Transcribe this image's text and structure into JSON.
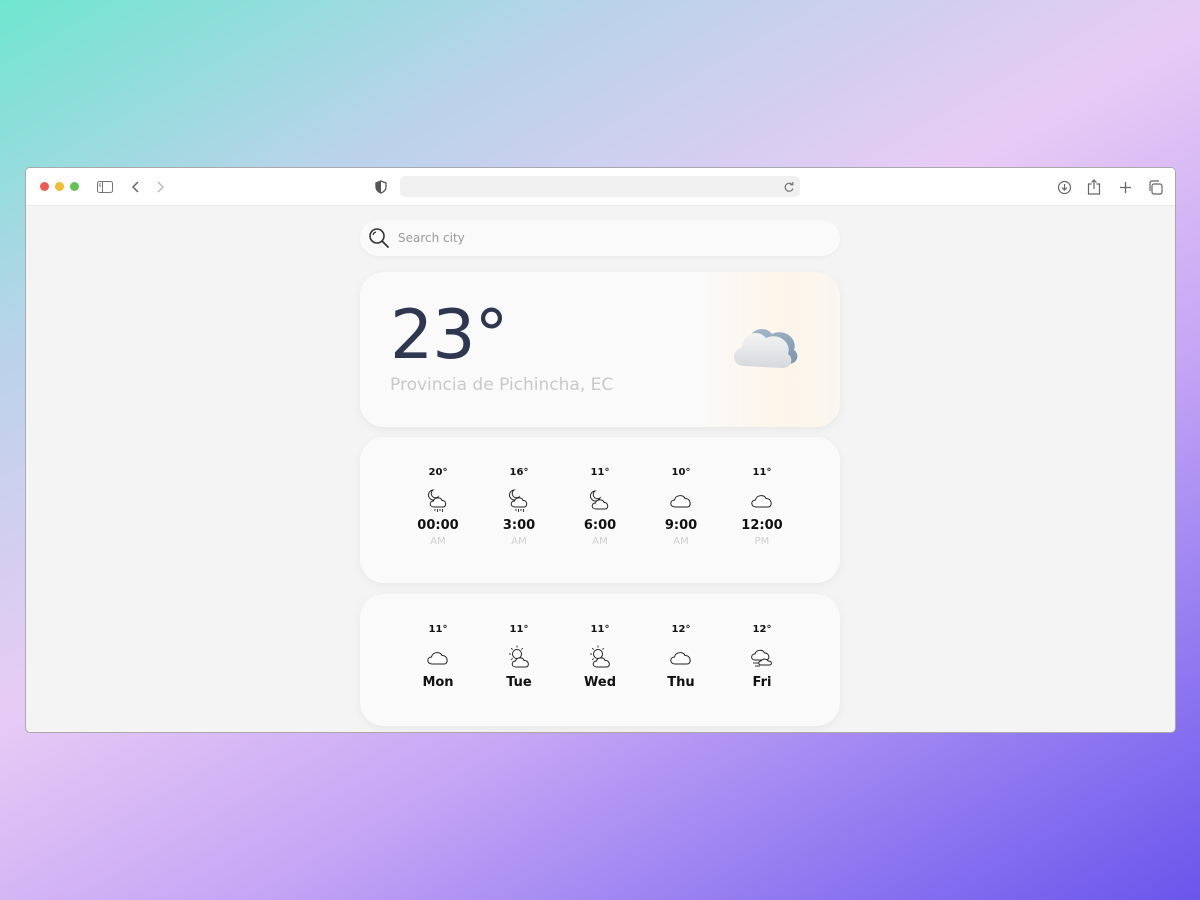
{
  "search": {
    "placeholder": "Search city"
  },
  "current": {
    "temperature": "23°",
    "location": "Provincia de Pichincha, EC",
    "icon": "cloud-icon"
  },
  "hourly": [
    {
      "temp": "20°",
      "icon": "night-rain-icon",
      "time": "00:00",
      "period": "AM"
    },
    {
      "temp": "16°",
      "icon": "night-rain-icon",
      "time": "3:00",
      "period": "AM"
    },
    {
      "temp": "11°",
      "icon": "night-cloud-icon",
      "time": "6:00",
      "period": "AM"
    },
    {
      "temp": "10°",
      "icon": "cloud-icon",
      "time": "9:00",
      "period": "AM"
    },
    {
      "temp": "11°",
      "icon": "cloud-icon",
      "time": "12:00",
      "period": "PM"
    }
  ],
  "daily": [
    {
      "temp": "11°",
      "icon": "cloud-icon",
      "day": "Mon"
    },
    {
      "temp": "11°",
      "icon": "sun-cloud-icon",
      "day": "Tue"
    },
    {
      "temp": "11°",
      "icon": "sun-cloud-icon",
      "day": "Wed"
    },
    {
      "temp": "12°",
      "icon": "cloud-icon",
      "day": "Thu"
    },
    {
      "temp": "12°",
      "icon": "fog-cloud-icon",
      "day": "Fri"
    }
  ],
  "colors": {
    "temperature_text": "#2f3650",
    "location_text": "#c9c9c9",
    "card_background": "#fafafa"
  }
}
